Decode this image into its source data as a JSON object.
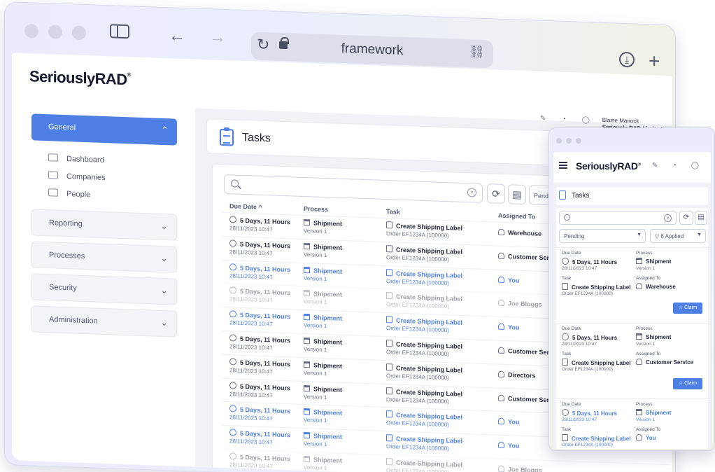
{
  "browser": {
    "url": "framework",
    "controls": {
      "sidebar_icon": "sidebar-icon",
      "back": "←",
      "forward": "→",
      "reload": "↻",
      "link": "🔗",
      "download": "⤓",
      "new_tab": "+"
    }
  },
  "brand": {
    "name": "SeriouslyRAD",
    "mark": "®"
  },
  "sidebar": {
    "general": {
      "label": "General",
      "chevron": "⌃"
    },
    "sub_items": [
      {
        "label": "Dashboard",
        "icon": "home-icon"
      },
      {
        "label": "Companies",
        "icon": "building-icon"
      },
      {
        "label": "People",
        "icon": "id-card-icon"
      }
    ],
    "sections": [
      {
        "label": "Reporting",
        "chevron": "⌄"
      },
      {
        "label": "Processes",
        "chevron": "⌄"
      },
      {
        "label": "Security",
        "chevron": "⌄"
      },
      {
        "label": "Administration",
        "chevron": "⌄"
      }
    ]
  },
  "topbar": {
    "user_name": "Blaine Manock",
    "org": "Seriously RAD Limited",
    "icons": "✎ ◔ ◯"
  },
  "tasks": {
    "title": "Tasks"
  },
  "toolbar": {
    "pending_label": "Pending",
    "refresh": "⟳",
    "export": "▤"
  },
  "table": {
    "headers": {
      "due": "Due Date ^",
      "process": "Process",
      "task": "Task",
      "assigned": "Assigned To"
    },
    "rows": [
      {
        "due": "5 Days, 11 Hours",
        "date": "28/11/2023 10:47",
        "process": "Shipment",
        "version": "Version 1",
        "task": "Create Shipping Label",
        "order": "Order EF1234A (100000)",
        "assigned": "Warehouse",
        "style": "normal"
      },
      {
        "due": "5 Days, 11 Hours",
        "date": "28/11/2023 10:47",
        "process": "Shipment",
        "version": "Version 1",
        "task": "Create Shipping Label",
        "order": "Order EF1234A (100000)",
        "assigned": "Customer Service",
        "style": "normal"
      },
      {
        "due": "5 Days, 11 Hours",
        "date": "28/11/2023 10:47",
        "process": "Shipment",
        "version": "Version 1",
        "task": "Create Shipping Label",
        "order": "Order EF1234A (100000)",
        "assigned": "You",
        "style": "blue"
      },
      {
        "due": "5 Days, 11 Hours",
        "date": "28/11/2023 10:47",
        "process": "Shipment",
        "version": "Version 1",
        "task": "Create Shipping Label",
        "order": "Order EF1234A (100000)",
        "assigned": "Joe Bloggs",
        "style": "faded"
      },
      {
        "due": "5 Days, 11 Hours",
        "date": "28/11/2023 10:47",
        "process": "Shipment",
        "version": "Version 1",
        "task": "Create Shipping Label",
        "order": "Order EF1234A (100000)",
        "assigned": "You",
        "style": "blue"
      },
      {
        "due": "5 Days, 11 Hours",
        "date": "28/11/2023 10:47",
        "process": "Shipment",
        "version": "Version 1",
        "task": "Create Shipping Label",
        "order": "Order EF1234A (100000)",
        "assigned": "Customer Service",
        "style": "normal"
      },
      {
        "due": "5 Days, 11 Hours",
        "date": "28/11/2023 10:47",
        "process": "Shipment",
        "version": "Version 1",
        "task": "Create Shipping Label",
        "order": "Order EF1234A (100000)",
        "assigned": "Directors",
        "style": "normal"
      },
      {
        "due": "5 Days, 11 Hours",
        "date": "28/11/2023 10:47",
        "process": "Shipment",
        "version": "Version 1",
        "task": "Create Shipping Label",
        "order": "Order EF1234A (100000)",
        "assigned": "Customer Service",
        "style": "normal"
      },
      {
        "due": "5 Days, 11 Hours",
        "date": "28/11/2023 10:47",
        "process": "Shipment",
        "version": "Version 1",
        "task": "Create Shipping Label",
        "order": "Order EF1234A (100000)",
        "assigned": "You",
        "style": "blue"
      },
      {
        "due": "5 Days, 11 Hours",
        "date": "28/11/2023 10:47",
        "process": "Shipment",
        "version": "Version 1",
        "task": "Create Shipping Label",
        "order": "Order EF1234A (100000)",
        "assigned": "You",
        "style": "blue"
      },
      {
        "due": "5 Days, 11 Hours",
        "date": "28/11/2023 10:47",
        "process": "Shipment",
        "version": "Version 1",
        "task": "Create Shipping Label",
        "order": "Order EF1234A (100000)",
        "assigned": "Joe Bloggs",
        "style": "faded"
      }
    ]
  },
  "mobile": {
    "brand": "SeriouslyRAD",
    "mark": "®",
    "icons": "✎ ◔ ◯",
    "title": "Tasks",
    "pending": "Pending",
    "filter": "6 Applied",
    "labels": {
      "due": "Due Date",
      "process": "Process",
      "task": "Task",
      "assigned": "Assigned To"
    },
    "claim": "Claim",
    "cards": [
      {
        "due": "5 Days, 11 Hours",
        "date": "28/11/2023 10:47",
        "process": "Shipment",
        "version": "Version 1",
        "task": "Create Shipping Label",
        "order": "Order EF1234A (100000)",
        "assigned": "Warehouse",
        "style": "normal"
      },
      {
        "due": "5 Days, 11 Hours",
        "date": "28/11/2023 10:47",
        "process": "Shipment",
        "version": "Version 1",
        "task": "Create Shipping Label",
        "order": "Order EF1234A (100000)",
        "assigned": "Customer Service",
        "style": "normal"
      },
      {
        "due": "5 Days, 11 Hours",
        "date": "28/11/2023 10:47",
        "process": "Shipment",
        "version": "Version 1",
        "task": "Create Shipping Label",
        "order": "Order EF1234A (100000)",
        "assigned": "You",
        "style": "blue"
      }
    ]
  },
  "colors": {
    "accent": "#4d7fe5",
    "text": "#23263a",
    "muted": "#6a6f86"
  }
}
